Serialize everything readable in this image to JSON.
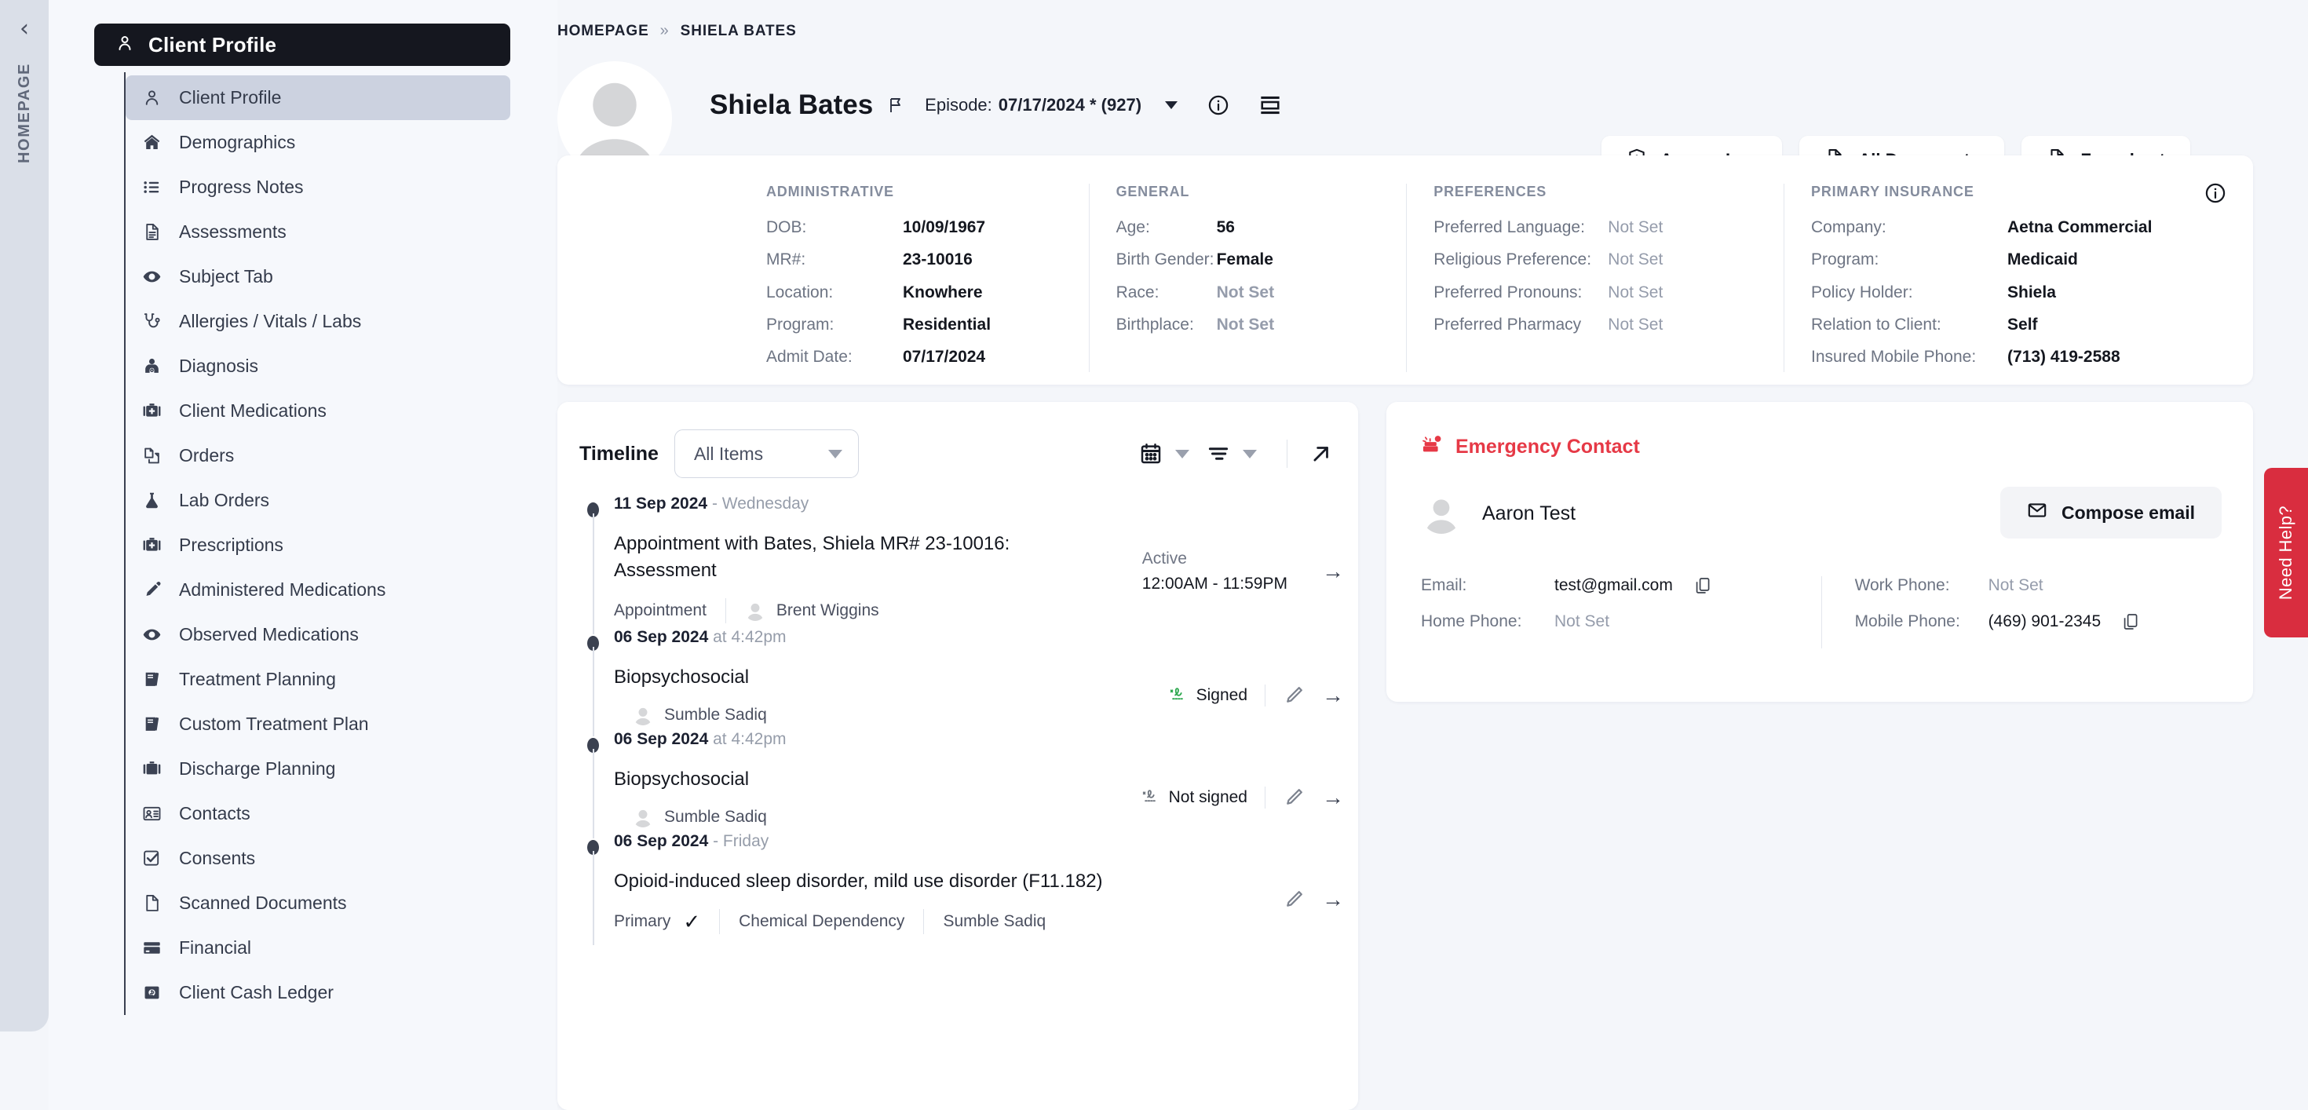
{
  "rail": {
    "collapse_icon": "chevron-left-icon",
    "label": "HOMEPAGE"
  },
  "sidebar": {
    "header": {
      "icon": "person-icon",
      "title": "Client Profile"
    },
    "items": [
      {
        "label": "Client Profile",
        "icon": "person-icon",
        "active": true
      },
      {
        "label": "Demographics",
        "icon": "home-icon",
        "active": false
      },
      {
        "label": "Progress Notes",
        "icon": "list-icon",
        "active": false
      },
      {
        "label": "Assessments",
        "icon": "document-icon",
        "active": false
      },
      {
        "label": "Subject Tab",
        "icon": "eye-icon",
        "active": false
      },
      {
        "label": "Allergies / Vitals / Labs",
        "icon": "stethoscope-icon",
        "active": false
      },
      {
        "label": "Diagnosis",
        "icon": "doctor-icon",
        "active": false
      },
      {
        "label": "Client Medications",
        "icon": "medical-bag-icon",
        "active": false
      },
      {
        "label": "Orders",
        "icon": "copy-documents-icon",
        "active": false
      },
      {
        "label": "Lab Orders",
        "icon": "flask-icon",
        "active": false
      },
      {
        "label": "Prescriptions",
        "icon": "medical-bag-icon",
        "active": false
      },
      {
        "label": "Administered Medications",
        "icon": "syringe-icon",
        "active": false
      },
      {
        "label": "Observed Medications",
        "icon": "eye-icon",
        "active": false
      },
      {
        "label": "Treatment Planning",
        "icon": "book-icon",
        "active": false
      },
      {
        "label": "Custom Treatment Plan",
        "icon": "book-icon",
        "active": false
      },
      {
        "label": "Discharge Planning",
        "icon": "briefcase-icon",
        "active": false
      },
      {
        "label": "Contacts",
        "icon": "id-card-icon",
        "active": false
      },
      {
        "label": "Consents",
        "icon": "checkbox-icon",
        "active": false
      },
      {
        "label": "Scanned Documents",
        "icon": "page-icon",
        "active": false
      },
      {
        "label": "Financial",
        "icon": "credit-card-icon",
        "active": false
      },
      {
        "label": "Client Cash Ledger",
        "icon": "cash-icon",
        "active": false
      }
    ]
  },
  "breadcrumb": {
    "home": "HOMEPAGE",
    "separator": "»",
    "current": "SHIELA BATES"
  },
  "header": {
    "avatar_icon": "avatar-placeholder-icon",
    "client_name": "Shiela Bates",
    "flag_icon": "flag-icon",
    "episode_label": "Episode:",
    "episode_value": "07/17/2024 * (927)",
    "dropdown_icon": "caret-down-icon",
    "info_icon": "info-circle-icon",
    "layout_icon": "layout-icon",
    "actions": [
      {
        "label": "Access Log",
        "icon": "shield-icon"
      },
      {
        "label": "All Documents",
        "icon": "document-lines-icon"
      },
      {
        "label": "Facesheet",
        "icon": "facesheet-icon"
      }
    ]
  },
  "info": {
    "info_icon": "info-circle-icon",
    "columns": [
      {
        "title": "ADMINISTRATIVE",
        "rows": [
          {
            "k": "DOB:",
            "v": "10/09/1967",
            "notset": false
          },
          {
            "k": "MR#:",
            "v": "23-10016",
            "notset": false
          },
          {
            "k": "Location:",
            "v": "Knowhere",
            "notset": false
          },
          {
            "k": "Program:",
            "v": "Residential",
            "notset": false
          },
          {
            "k": "Admit Date:",
            "v": "07/17/2024",
            "notset": false
          }
        ]
      },
      {
        "title": "GENERAL",
        "rows": [
          {
            "k": "Age:",
            "v": "56",
            "notset": false
          },
          {
            "k": "Birth Gender:",
            "v": "Female",
            "notset": false
          },
          {
            "k": "Race:",
            "v": "Not Set",
            "notset": true
          },
          {
            "k": "Birthplace:",
            "v": "Not Set",
            "notset": true
          }
        ]
      },
      {
        "title": "PREFERENCES",
        "rows": [
          {
            "k": "Preferred Language:",
            "v": "Not Set",
            "notset": true
          },
          {
            "k": "Religious Preference:",
            "v": "Not Set",
            "notset": true
          },
          {
            "k": "Preferred Pronouns:",
            "v": "Not Set",
            "notset": true
          },
          {
            "k": "Preferred Pharmacy",
            "v": "Not Set",
            "notset": true
          }
        ]
      },
      {
        "title": "PRIMARY INSURANCE",
        "rows": [
          {
            "k": "Company:",
            "v": "Aetna Commercial",
            "notset": false
          },
          {
            "k": "Program:",
            "v": "Medicaid",
            "notset": false
          },
          {
            "k": "Policy Holder:",
            "v": "Shiela",
            "notset": false
          },
          {
            "k": "Relation to Client:",
            "v": "Self",
            "notset": false
          },
          {
            "k": "Insured Mobile Phone:",
            "v": "(713) 419-2588",
            "notset": false
          }
        ]
      }
    ]
  },
  "timeline": {
    "title": "Timeline",
    "filter_value": "All Items",
    "calendar_icon": "calendar-icon",
    "sort_icon": "filter-lines-icon",
    "expand_icon": "expand-arrow-icon",
    "items": [
      {
        "date": "11 Sep 2024",
        "date_suffix": "- Wednesday",
        "subject": "Appointment with Bates, Shiela MR# 23-10016: Assessment",
        "chip": "Appointment",
        "person": "Brent Wiggins",
        "status_line1": "Active",
        "status_line2": "12:00AM - 11:59PM",
        "has_pen": false,
        "sign_status": ""
      },
      {
        "date": "06 Sep 2024",
        "date_suffix": "at 4:42pm",
        "subject": "Biopsychosocial",
        "chip": "",
        "person": "Sumble Sadiq",
        "status_line1": "",
        "status_line2": "",
        "has_pen": true,
        "sign_status": "Signed"
      },
      {
        "date": "06 Sep 2024",
        "date_suffix": "at 4:42pm",
        "subject": "Biopsychosocial",
        "chip": "",
        "person": "Sumble Sadiq",
        "status_line1": "",
        "status_line2": "",
        "has_pen": true,
        "sign_status": "Not signed"
      },
      {
        "date": "06 Sep 2024",
        "date_suffix": "- Friday",
        "subject": "Opioid-induced sleep disorder, mild use disorder (F11.182)",
        "chip": "Primary",
        "chip2": "Chemical Dependency",
        "person": "Sumble Sadiq",
        "status_line1": "",
        "status_line2": "",
        "has_pen": true,
        "sign_status": ""
      }
    ]
  },
  "emergency_contact": {
    "title": "Emergency Contact",
    "title_icon": "emergency-icon",
    "title_color": "#e63946",
    "name": "Aaron Test",
    "compose_label": "Compose email",
    "compose_icon": "envelope-icon",
    "left_rows": [
      {
        "k": "Email:",
        "v": "test@gmail.com",
        "notset": false,
        "copy": true
      },
      {
        "k": "Home Phone:",
        "v": "Not Set",
        "notset": true,
        "copy": false
      }
    ],
    "right_rows": [
      {
        "k": "Work Phone:",
        "v": "Not Set",
        "notset": true,
        "copy": false
      },
      {
        "k": "Mobile Phone:",
        "v": "(469) 901-2345",
        "notset": false,
        "copy": true
      }
    ]
  },
  "need_help": {
    "label": "Need Help?",
    "color": "#d92d3f"
  }
}
